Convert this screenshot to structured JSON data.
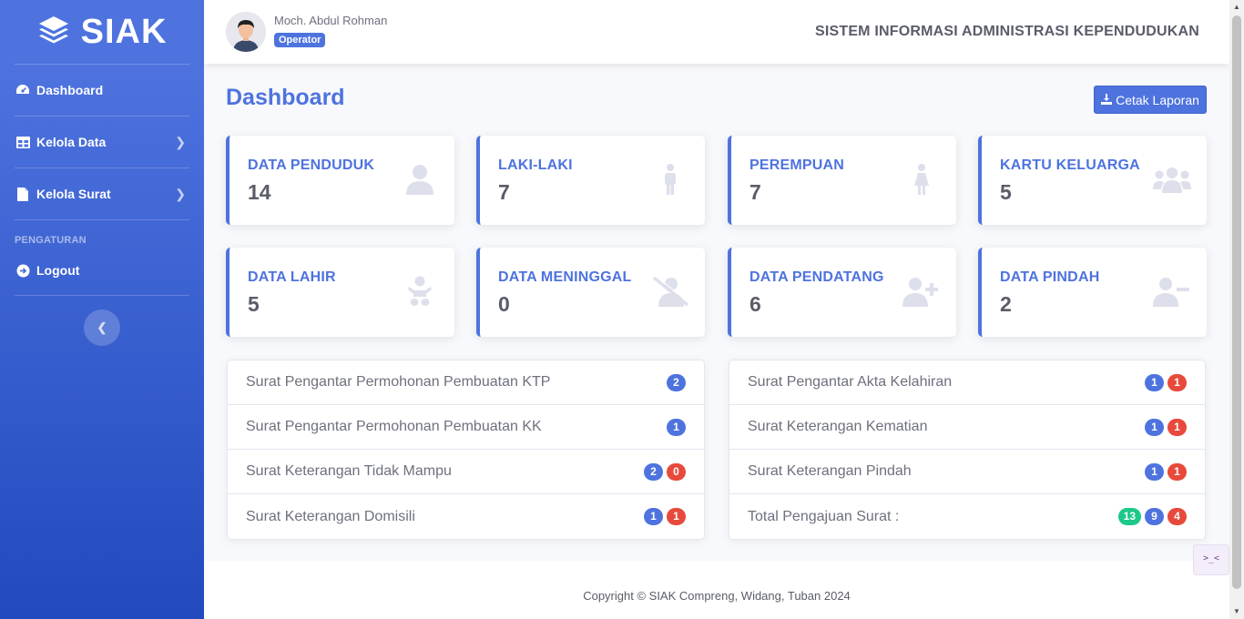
{
  "brand": {
    "name": "SIAK"
  },
  "sidebar": {
    "items": [
      {
        "label": "Dashboard",
        "icon": "dashboard-icon"
      },
      {
        "label": "Kelola Data",
        "icon": "table-icon"
      },
      {
        "label": "Kelola Surat",
        "icon": "file-icon"
      }
    ],
    "heading": "PENGATURAN",
    "logout": {
      "label": "Logout",
      "icon": "logout-icon"
    }
  },
  "user": {
    "name": "Moch. Abdul Rohman",
    "role": "Operator"
  },
  "topbar": {
    "system_title": "SISTEM INFORMASI ADMINISTRASI KEPENDUDUKAN"
  },
  "page": {
    "title": "Dashboard",
    "print_button": "Cetak Laporan"
  },
  "stats": [
    {
      "label": "DATA PENDUDUK",
      "value": "14",
      "icon": "user-icon"
    },
    {
      "label": "LAKI-LAKI",
      "value": "7",
      "icon": "male-icon"
    },
    {
      "label": "PEREMPUAN",
      "value": "7",
      "icon": "female-icon"
    },
    {
      "label": "KARTU KELUARGA",
      "value": "5",
      "icon": "users-icon"
    },
    {
      "label": "DATA LAHIR",
      "value": "5",
      "icon": "baby-icon"
    },
    {
      "label": "DATA MENINGGAL",
      "value": "0",
      "icon": "user-slash-icon"
    },
    {
      "label": "DATA PENDATANG",
      "value": "6",
      "icon": "user-plus-icon"
    },
    {
      "label": "DATA PINDAH",
      "value": "2",
      "icon": "user-minus-icon"
    }
  ],
  "letters_left": [
    {
      "label": "Surat Pengantar Permohonan Pembuatan KTP",
      "badges": [
        {
          "value": "2",
          "color": "blue"
        }
      ]
    },
    {
      "label": "Surat Pengantar Permohonan Pembuatan KK",
      "badges": [
        {
          "value": "1",
          "color": "blue"
        }
      ]
    },
    {
      "label": "Surat Keterangan Tidak Mampu",
      "badges": [
        {
          "value": "2",
          "color": "blue"
        },
        {
          "value": "0",
          "color": "red"
        }
      ]
    },
    {
      "label": "Surat Keterangan Domisili",
      "badges": [
        {
          "value": "1",
          "color": "blue"
        },
        {
          "value": "1",
          "color": "red"
        }
      ]
    }
  ],
  "letters_right": [
    {
      "label": "Surat Pengantar Akta Kelahiran",
      "badges": [
        {
          "value": "1",
          "color": "blue"
        },
        {
          "value": "1",
          "color": "red"
        }
      ]
    },
    {
      "label": "Surat Keterangan Kematian",
      "badges": [
        {
          "value": "1",
          "color": "blue"
        },
        {
          "value": "1",
          "color": "red"
        }
      ]
    },
    {
      "label": "Surat Keterangan Pindah",
      "badges": [
        {
          "value": "1",
          "color": "blue"
        },
        {
          "value": "1",
          "color": "red"
        }
      ]
    },
    {
      "label": "Total Pengajuan Surat :",
      "badges": [
        {
          "value": "13",
          "color": "green"
        },
        {
          "value": "9",
          "color": "blue"
        },
        {
          "value": "4",
          "color": "red"
        }
      ]
    }
  ],
  "footer": {
    "copyright": "Copyright © SIAK Compreng, Widang, Tuban 2024"
  },
  "colors": {
    "primary": "#4e73df",
    "danger": "#e74a3b",
    "success": "#1cc88a"
  }
}
